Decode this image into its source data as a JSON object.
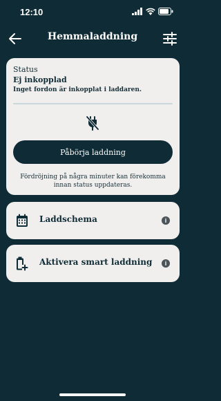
{
  "status_bar": {
    "time": "12:10",
    "icons": [
      "signal-icon",
      "wifi-icon",
      "battery-icon"
    ]
  },
  "header": {
    "title": "Hemmaladdning",
    "back_icon": "arrow-left-icon",
    "settings_icon": "sliders-icon"
  },
  "status_card": {
    "label": "Status",
    "value": "Ej inkopplad",
    "description": "Inget fordon är inkopplat i laddaren.",
    "progress": 0,
    "plug_icon": "plug-unplugged-icon",
    "button_label": "Påbörja laddning",
    "note": "Fördröjning på några minuter kan förekomma innan status uppdateras."
  },
  "options": [
    {
      "label": "Laddschema",
      "icon": "calendar-icon"
    },
    {
      "label": "Aktivera smart laddning",
      "icon": "battery-plus-icon"
    }
  ],
  "colors": {
    "background": "#0f2c36",
    "card": "#f0efed",
    "primary": "#0f2c36",
    "info": "#4b5559"
  }
}
